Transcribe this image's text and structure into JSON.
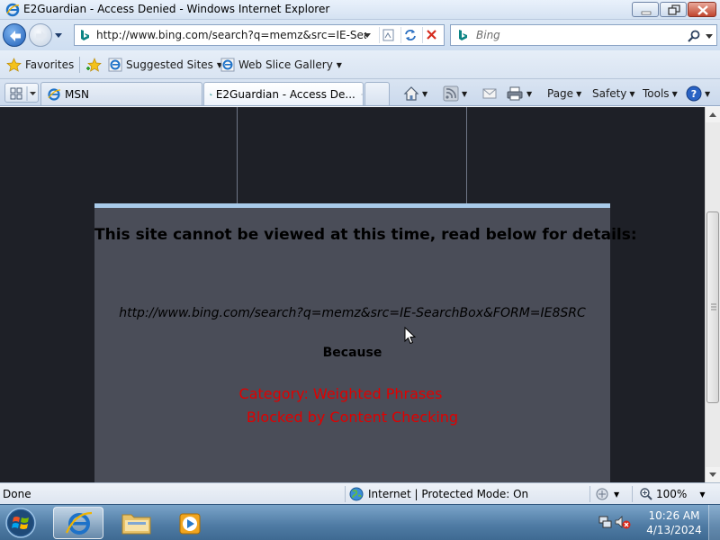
{
  "window": {
    "title": "E2Guardian - Access Denied - Windows Internet Explorer"
  },
  "address_bar": {
    "url": "http://www.bing.com/search?q=memz&src=IE-SearchI"
  },
  "search_box": {
    "placeholder": "Bing"
  },
  "favorites_bar": {
    "favorites_label": "Favorites",
    "suggested_sites_label": "Suggested Sites",
    "web_slice_gallery_label": "Web Slice Gallery"
  },
  "tabs": [
    {
      "label": "MSN",
      "active": false
    },
    {
      "label": "E2Guardian - Access De...",
      "active": true
    }
  ],
  "command_bar": {
    "page_label": "Page",
    "safety_label": "Safety",
    "tools_label": "Tools"
  },
  "content": {
    "heading": "This site cannot be viewed at this time, read below for details:",
    "blocked_url": "http://www.bing.com/search?q=memz&src=IE-SearchBox&FORM=IE8SRC",
    "because_label": "Because",
    "reason_line1": "Category: Weighted Phrases",
    "reason_line2": "Blocked by Content Checking",
    "reason_color": "#e00000",
    "panel_color": "#4a4d58",
    "background_color": "#1e2027"
  },
  "status_bar": {
    "status_text": "Done",
    "zone_text": "Internet | Protected Mode: On",
    "zoom_text": "100%"
  },
  "taskbar": {
    "pinned": [
      "internet-explorer-icon",
      "windows-explorer-icon",
      "media-player-icon"
    ],
    "clock_time": "10:26 AM",
    "clock_date": "4/13/2024"
  }
}
